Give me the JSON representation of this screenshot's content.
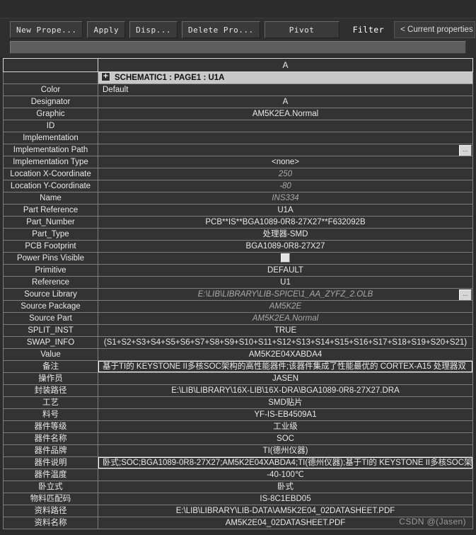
{
  "toolbar": {
    "buttons": [
      {
        "name": "new-property",
        "label": "New Prope..."
      },
      {
        "name": "apply",
        "label": "Apply"
      },
      {
        "name": "display",
        "label": "Disp..."
      },
      {
        "name": "delete-property",
        "label": "Delete Pro..."
      },
      {
        "name": "pivot",
        "label": "Pivot"
      }
    ],
    "filter_label": "Filter",
    "filter_value": "< Current properties >"
  },
  "grid": {
    "column_header": "A",
    "instance": {
      "expander": "+",
      "label": "SCHEMATIC1 : PAGE1 : U1A"
    },
    "rows": [
      {
        "label": "Color",
        "value": "Default",
        "align": "left",
        "style": "plain"
      },
      {
        "label": "Designator",
        "value": "A",
        "align": "center",
        "style": "plain"
      },
      {
        "label": "Graphic",
        "value": "AM5K2EA.Normal",
        "align": "center",
        "style": "plain"
      },
      {
        "label": "ID",
        "value": "",
        "align": "center",
        "style": "hatch"
      },
      {
        "label": "Implementation",
        "value": "",
        "align": "center",
        "style": "plain"
      },
      {
        "label": "Implementation Path",
        "value": "",
        "align": "left",
        "style": "browse"
      },
      {
        "label": "Implementation Type",
        "value": "<none>",
        "align": "center",
        "style": "plain"
      },
      {
        "label": "Location X-Coordinate",
        "value": "250",
        "align": "center",
        "style": "italic"
      },
      {
        "label": "Location Y-Coordinate",
        "value": "-80",
        "align": "center",
        "style": "italic"
      },
      {
        "label": "Name",
        "value": "INS334",
        "align": "center",
        "style": "italic"
      },
      {
        "label": "Part Reference",
        "value": "U1A",
        "align": "center",
        "style": "plain"
      },
      {
        "label": "Part_Number",
        "value": "PCB**IS**BGA1089-0R8-27X27**F632092B",
        "align": "center",
        "style": "plain"
      },
      {
        "label": "Part_Type",
        "value": "处理器-SMD",
        "align": "center",
        "style": "plain"
      },
      {
        "label": "PCB Footprint",
        "value": "BGA1089-0R8-27X27",
        "align": "center",
        "style": "plain"
      },
      {
        "label": "Power Pins Visible",
        "value": "",
        "align": "center",
        "style": "checkbox"
      },
      {
        "label": "Primitive",
        "value": "DEFAULT",
        "align": "center",
        "style": "plain"
      },
      {
        "label": "Reference",
        "value": "U1",
        "align": "center",
        "style": "plain"
      },
      {
        "label": "Source Library",
        "value": "E:\\LIB\\LIBRARY\\LIB-SPICE\\1_AA_ZYFZ_2.OLB",
        "align": "center",
        "style": "italic-browse"
      },
      {
        "label": "Source Package",
        "value": "AM5K2E",
        "align": "center",
        "style": "italic"
      },
      {
        "label": "Source Part",
        "value": "AM5K2EA.Normal",
        "align": "center",
        "style": "italic"
      },
      {
        "label": "SPLIT_INST",
        "value": "TRUE",
        "align": "center",
        "style": "hatch"
      },
      {
        "label": "SWAP_INFO",
        "value": "(S1+S2+S3+S4+S5+S6+S7+S8+S9+S10+S11+S12+S13+S14+S15+S16+S17+S18+S19+S20+S21)",
        "align": "center",
        "style": "hatch"
      },
      {
        "label": "Value",
        "value": "AM5K2E04XABDA4",
        "align": "center",
        "style": "plain"
      },
      {
        "label": "备注",
        "value": "基于TI的 KEYSTONE II多核SOC架构的高性能器件;该器件集成了性能最优的 CORTEX-A15 处理器双",
        "align": "left",
        "style": "focus"
      },
      {
        "label": "操作员",
        "value": "JASEN",
        "align": "center",
        "style": "plain"
      },
      {
        "label": "封装路径",
        "value": "E:\\LIB\\LIBRARY\\16X-LIB\\16X-DRA\\BGA1089-0R8-27X27.DRA",
        "align": "center",
        "style": "plain"
      },
      {
        "label": "工艺",
        "value": "SMD贴片",
        "align": "center",
        "style": "plain"
      },
      {
        "label": "料号",
        "value": "YF-IS-EB4509A1",
        "align": "center",
        "style": "plain"
      },
      {
        "label": "器件等级",
        "value": "工业级",
        "align": "center",
        "style": "plain"
      },
      {
        "label": "器件名称",
        "value": "SOC",
        "align": "center",
        "style": "plain"
      },
      {
        "label": "器件品牌",
        "value": "TI(德州仪器)",
        "align": "center",
        "style": "plain"
      },
      {
        "label": "器件说明",
        "value": "卧式;SOC;BGA1089-0R8-27X27;AM5K2E04XABDA4;TI(德州仪器);基于TI的 KEYSTONE II多核SOC架构",
        "align": "left",
        "style": "focus"
      },
      {
        "label": "器件温度",
        "value": "-40-100℃",
        "align": "center",
        "style": "plain"
      },
      {
        "label": "卧立式",
        "value": "卧式",
        "align": "center",
        "style": "plain"
      },
      {
        "label": "物料匹配码",
        "value": "IS-8C1EBD05",
        "align": "center",
        "style": "plain"
      },
      {
        "label": "资料路径",
        "value": "E:\\LIB\\LIBRARY\\LIB-DATA\\AM5K2E04_02DATASHEET.PDF",
        "align": "center",
        "style": "plain"
      },
      {
        "label": "资料名称",
        "value": "AM5K2E04_02DATASHEET.PDF",
        "align": "center",
        "style": "plain"
      }
    ]
  },
  "watermark": "CSDN @(Jasen)",
  "colors": {
    "window_bg": "#2b2b2b",
    "cell_bg": "#333333",
    "cell_border": "#7d7d7d",
    "selected_row_bg": "#c8c8c8",
    "text": "#e9e9e9",
    "muted_text": "#a9a9a9"
  }
}
